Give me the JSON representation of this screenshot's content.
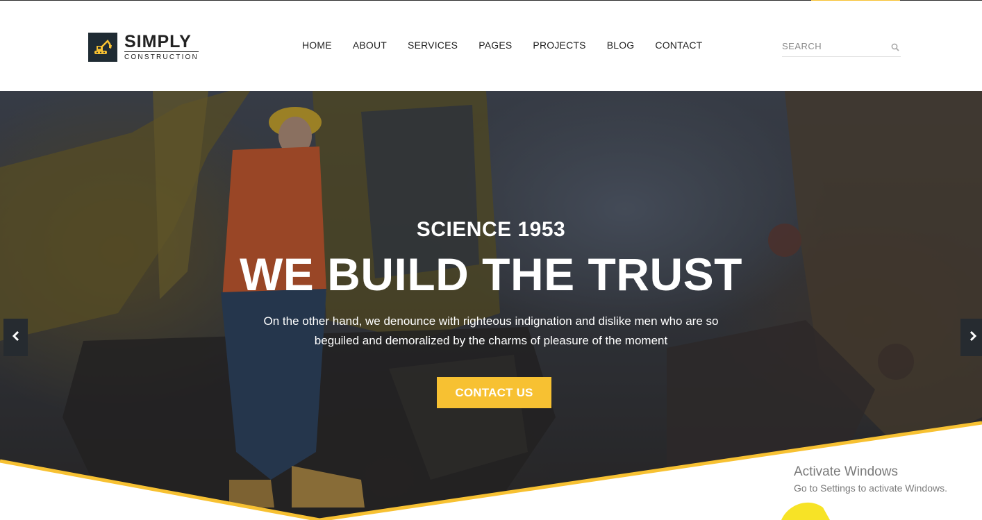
{
  "brand": {
    "name": "SIMPLY",
    "tagline": "CONSTRUCTION"
  },
  "nav": {
    "items": [
      "HOME",
      "ABOUT",
      "SERVICES",
      "PAGES",
      "PROJECTS",
      "BLOG",
      "CONTACT"
    ]
  },
  "search": {
    "placeholder": "SEARCH"
  },
  "hero": {
    "kicker": "SCIENCE 1953",
    "title": "WE BUILD THE TRUST",
    "text": "On the other hand, we denounce with righteous indignation and dislike men who are so beguiled and demoralized by the charms of pleasure of the moment",
    "cta": "CONTACT US"
  },
  "watermark": {
    "title": "Activate Windows",
    "subtitle": "Go to Settings to activate Windows."
  },
  "colors": {
    "accent": "#f7c132",
    "dark": "#1f2b33",
    "text": "#222222"
  },
  "icons": {
    "logo": "excavator-icon",
    "search": "search-icon",
    "prev": "chevron-left-icon",
    "next": "chevron-right-icon"
  }
}
